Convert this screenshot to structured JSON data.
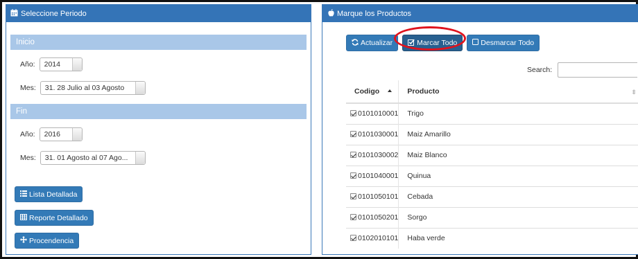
{
  "left_panel": {
    "title": "Seleccione Periodo",
    "inicio": {
      "section_label": "Inicio",
      "anio_label": "Año:",
      "anio_value": "2014",
      "mes_label": "Mes:",
      "mes_value": "31. 28 Julio al 03 Agosto"
    },
    "fin": {
      "section_label": "Fin",
      "anio_label": "Año:",
      "anio_value": "2016",
      "mes_label": "Mes:",
      "mes_value": "31. 01 Agosto al 07 Ago..."
    },
    "buttons": {
      "lista": "Lista Detallada",
      "reporte": "Reporte Detallado",
      "procedencia": "Procendencia"
    }
  },
  "right_panel": {
    "title": "Marque los Productos",
    "toolbar": {
      "actualizar": "Actualizar",
      "marcar_todo": "Marcar Todo",
      "desmarcar_todo": "Desmarcar Todo"
    },
    "search_label": "Search:",
    "search_value": "",
    "table": {
      "headers": [
        "Codigo",
        "Producto"
      ],
      "rows": [
        {
          "codigo": "0101010001",
          "producto": "Trigo",
          "checked": true
        },
        {
          "codigo": "0101030001",
          "producto": "Maiz Amarillo",
          "checked": true
        },
        {
          "codigo": "0101030002",
          "producto": "Maiz Blanco",
          "checked": true
        },
        {
          "codigo": "0101040001",
          "producto": "Quinua",
          "checked": true
        },
        {
          "codigo": "0101050101",
          "producto": "Cebada",
          "checked": true
        },
        {
          "codigo": "0101050201",
          "producto": "Sorgo",
          "checked": true
        },
        {
          "codigo": "0102010101",
          "producto": "Haba verde",
          "checked": true
        }
      ]
    }
  },
  "colors": {
    "primary": "#337ab7",
    "panel_header": "#3474b7",
    "section_bar": "#a9c7e8",
    "highlight": "#e0131d"
  }
}
